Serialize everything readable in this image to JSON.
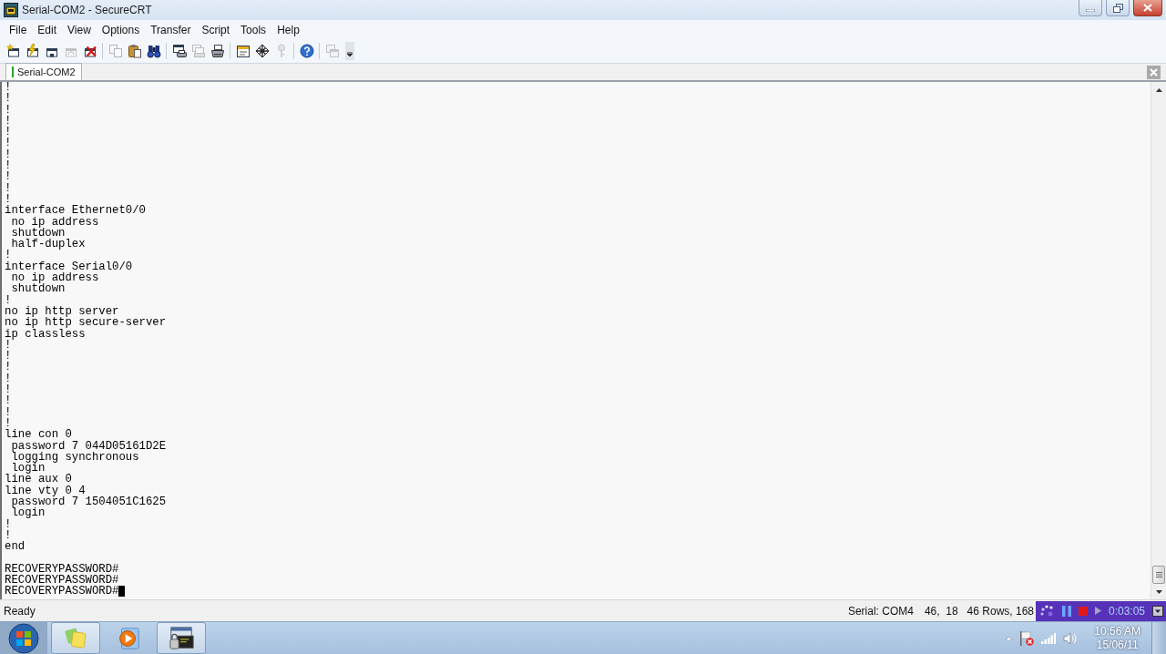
{
  "window": {
    "title": "Serial-COM2 - SecureCRT"
  },
  "menu": [
    "File",
    "Edit",
    "View",
    "Options",
    "Transfer",
    "Script",
    "Tools",
    "Help"
  ],
  "toolbar": {
    "groups": [
      {
        "buttons": [
          {
            "disabled": false
          },
          {
            "disabled": false
          },
          {
            "disabled": false
          },
          {
            "disabled": true
          },
          {
            "disabled": false
          }
        ]
      },
      {
        "buttons": [
          {
            "disabled": true
          },
          {
            "disabled": false
          },
          {
            "disabled": false
          }
        ]
      },
      {
        "buttons": [
          {
            "disabled": false
          },
          {
            "disabled": true
          },
          {
            "disabled": false
          }
        ]
      },
      {
        "buttons": [
          {
            "disabled": false
          },
          {
            "disabled": false
          },
          {
            "disabled": true
          }
        ]
      },
      {
        "buttons": [
          {
            "disabled": false
          }
        ]
      },
      {
        "buttons": [
          {
            "disabled": true
          }
        ]
      }
    ]
  },
  "tabs": [
    {
      "label": "Serial-COM2",
      "selected": true
    }
  ],
  "terminal": {
    "lines": [
      "!",
      "!",
      "!",
      "!",
      "!",
      "!",
      "!",
      "!",
      "!",
      "!",
      "!",
      "interface Ethernet0/0",
      " no ip address",
      " shutdown",
      " half-duplex",
      "!",
      "interface Serial0/0",
      " no ip address",
      " shutdown",
      "!",
      "no ip http server",
      "no ip http secure-server",
      "ip classless",
      "!",
      "!",
      "!",
      "!",
      "!",
      "!",
      "!",
      "!",
      "line con 0",
      " password 7 044D05161D2E",
      " logging synchronous",
      " login",
      "line aux 0",
      "line vty 0 4",
      " password 7 1504051C1625",
      " login",
      "!",
      "!",
      "end"
    ],
    "prompts": [
      {
        "text": "RECOVERYPASSWORD#",
        "cursor": false
      },
      {
        "text": "RECOVERYPASSWORD#",
        "cursor": false
      },
      {
        "text": "RECOVERYPASSWORD#",
        "cursor": true
      }
    ]
  },
  "status_bar": {
    "message": "Ready",
    "port": "Serial: COM4",
    "position": "46,  18",
    "size": "46 Rows, 168"
  },
  "recorder": {
    "elapsed": "0:03:05"
  },
  "taskbar": {
    "apps": [
      {
        "running": true
      },
      {
        "running": false
      },
      {
        "running": true
      }
    ],
    "clock": {
      "time": "10:56 AM",
      "date": "15/06/11"
    }
  }
}
